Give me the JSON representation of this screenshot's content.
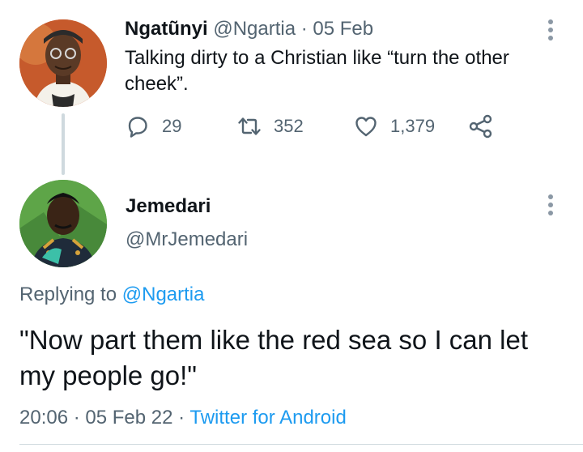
{
  "tweet1": {
    "name": "Ngatũnyi",
    "handle": "@Ngartia",
    "sep": " · ",
    "date": "05 Feb",
    "text": "Talking dirty to a Christian like “turn the other cheek”.",
    "replies": "29",
    "retweets": "352",
    "likes": "1,379"
  },
  "tweet2": {
    "name": "Jemedari",
    "handle": "@MrJemedari",
    "replying_prefix": "Replying to ",
    "replying_to": "@Ngartia",
    "text": "\"Now part them like the red sea so I can let my people go!\"",
    "time": "20:06",
    "sep": " · ",
    "date": "05 Feb 22",
    "source": "Twitter for Android"
  },
  "icons": {
    "reply": "reply-icon",
    "retweet": "retweet-icon",
    "like": "heart-icon",
    "share": "share-icon",
    "more": "more-options-icon"
  },
  "colors": {
    "accent": "#1d9bf0",
    "text": "#0f1419",
    "muted": "#536471",
    "line": "#cfd9de"
  }
}
